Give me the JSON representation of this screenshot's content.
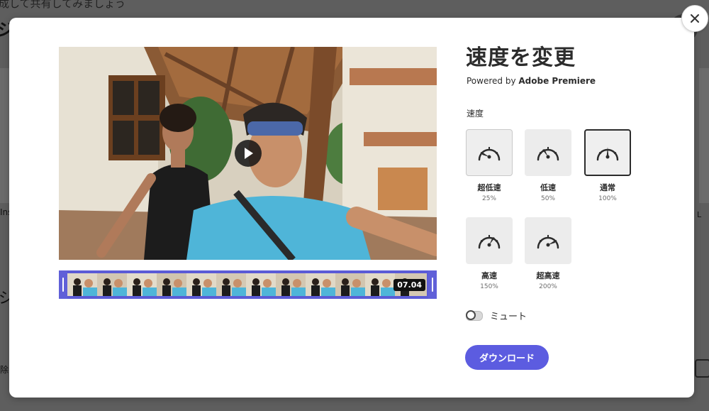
{
  "background": {
    "top_text": "成して共有してみましょう",
    "heading": "ジ",
    "left_text1": "Ins",
    "left_text2": "ジ",
    "left_text3": "除",
    "right_text": "L"
  },
  "modal": {
    "title": "速度を変更",
    "powered_prefix": "Powered by ",
    "powered_brand": "Adobe Premiere",
    "speed_label": "速度",
    "speeds": [
      {
        "name": "超低速",
        "pct": "25%",
        "icon": "gauge-slowest-icon"
      },
      {
        "name": "低速",
        "pct": "50%",
        "icon": "gauge-slow-icon"
      },
      {
        "name": "通常",
        "pct": "100%",
        "icon": "gauge-normal-icon"
      },
      {
        "name": "高速",
        "pct": "150%",
        "icon": "gauge-fast-icon"
      },
      {
        "name": "超高速",
        "pct": "200%",
        "icon": "gauge-fastest-icon"
      }
    ],
    "selected_speed": "通常",
    "mute_label": "ミュート",
    "download_label": "ダウンロード",
    "clip_duration": "07.04"
  },
  "colors": {
    "accent": "#5c5ce0",
    "trim_track": "#5b5bd6"
  }
}
